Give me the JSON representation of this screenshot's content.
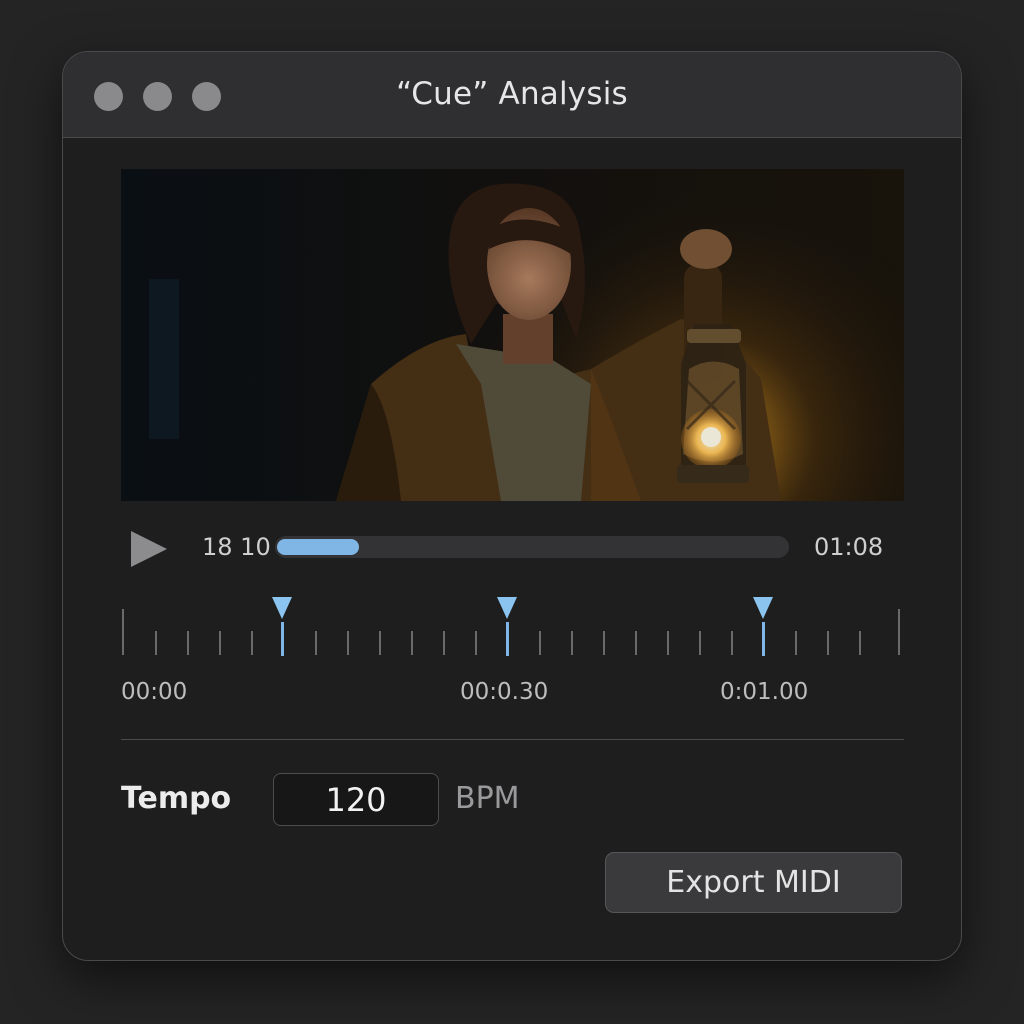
{
  "window": {
    "title": "“Cue” Analysis"
  },
  "player": {
    "current_time": "18 10",
    "end_time": "01:08",
    "progress": 0.16
  },
  "timeline": {
    "labels": [
      "00:00",
      "00:0.30",
      "0:01.00"
    ],
    "cue_markers": 3
  },
  "tempo": {
    "label": "Tempo",
    "value": "120",
    "unit": "BPM"
  },
  "actions": {
    "export_label": "Export MIDI"
  },
  "colors": {
    "accent": "#7fb6e6",
    "window_bg": "#1e1e1f",
    "titlebar_bg": "#2f2f31"
  }
}
